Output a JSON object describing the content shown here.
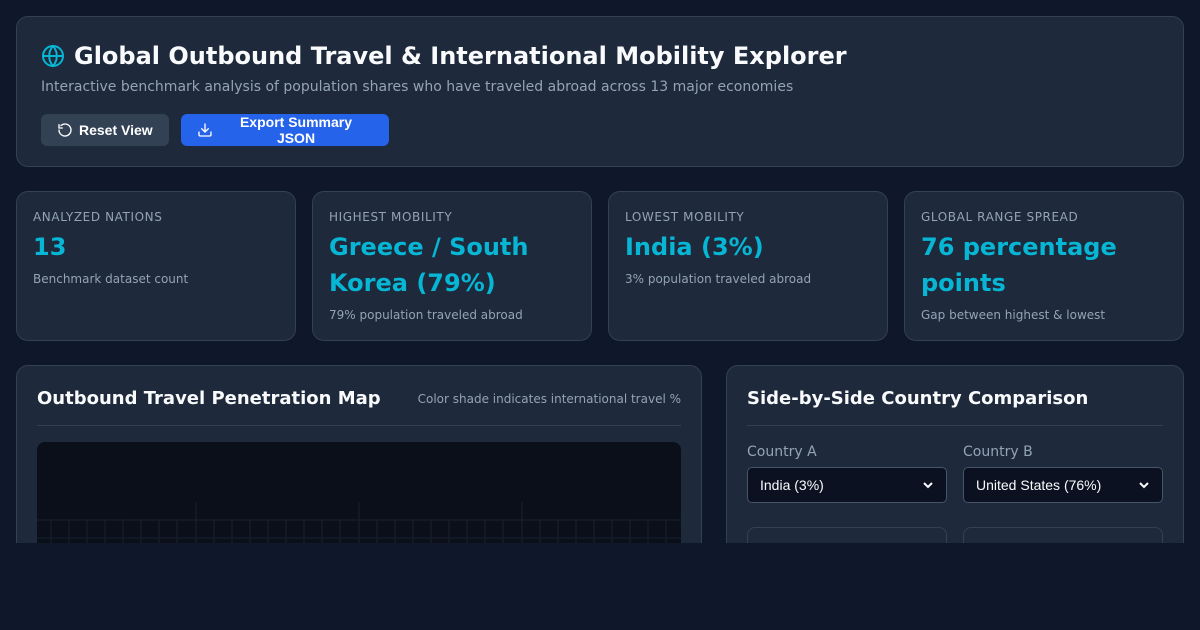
{
  "header": {
    "title": "Global Outbound Travel & International Mobility Explorer",
    "subtitle": "Interactive benchmark analysis of population shares who have traveled abroad across 13 major economies",
    "title_icon": "globe-icon",
    "buttons": {
      "reset_label": "Reset View",
      "reset_icon": "reset-icon",
      "export_label": "Export Summary JSON",
      "export_icon": "download-icon"
    }
  },
  "stats": [
    {
      "label": "Analyzed Nations",
      "value": "13",
      "desc": "Benchmark dataset count"
    },
    {
      "label": "Highest Mobility",
      "value": "Greece / South Korea (79%)",
      "desc": "79% population traveled abroad"
    },
    {
      "label": "Lowest Mobility",
      "value": "India (3%)",
      "desc": "3% population traveled abroad"
    },
    {
      "label": "Global Range Spread",
      "value": "76 percentage points",
      "desc": "Gap between highest & lowest"
    }
  ],
  "map_panel": {
    "title": "Outbound Travel Penetration Map",
    "note": "Color shade indicates international travel %"
  },
  "compare_panel": {
    "title": "Side-by-Side Country Comparison",
    "country_a_label": "Country A",
    "country_a_value": "India (3%)",
    "country_b_label": "Country B",
    "country_b_value": "United States (76%)"
  },
  "colors": {
    "accent": "#06b6d4",
    "primary_button": "#2563eb",
    "secondary_button": "#334155",
    "background": "#0f172a",
    "card": "#1e293b"
  }
}
